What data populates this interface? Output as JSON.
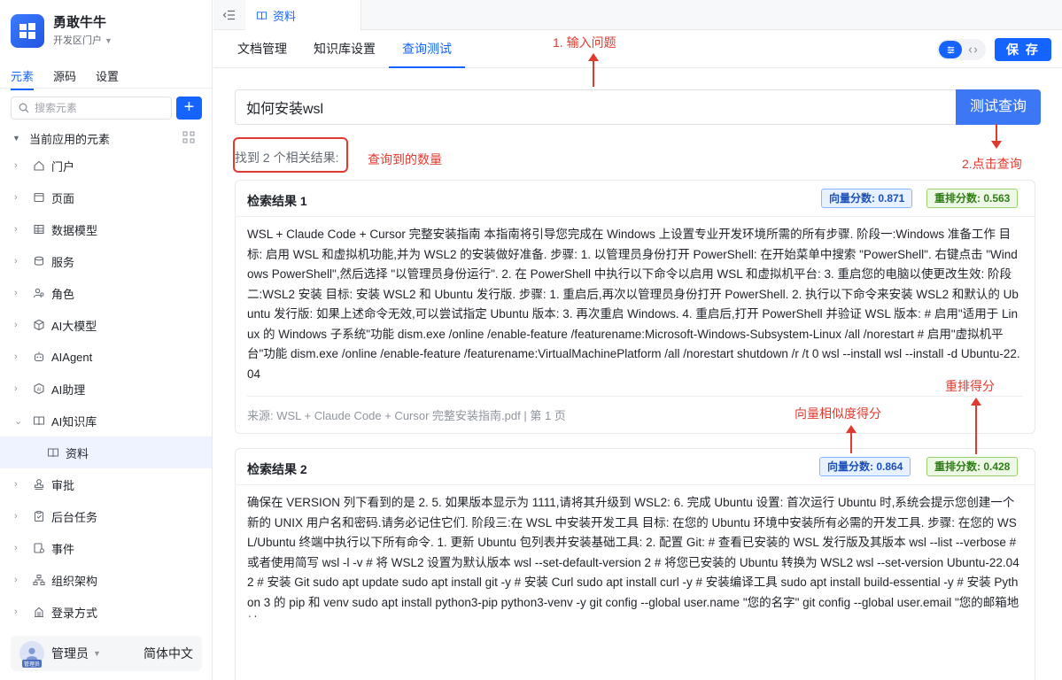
{
  "app": {
    "name": "勇敢牛牛",
    "subtitle": "开发区门户"
  },
  "sidebar": {
    "tabs": [
      {
        "label": "元素"
      },
      {
        "label": "源码"
      },
      {
        "label": "设置"
      }
    ],
    "search_placeholder": "搜索元素",
    "add_label": "+",
    "tree_title": "当前应用的元素",
    "items": [
      {
        "label": "门户"
      },
      {
        "label": "页面"
      },
      {
        "label": "数据模型"
      },
      {
        "label": "服务"
      },
      {
        "label": "角色"
      },
      {
        "label": "AI大模型"
      },
      {
        "label": "AIAgent"
      },
      {
        "label": "AI助理"
      },
      {
        "label": "AI知识库"
      },
      {
        "label": "资料"
      },
      {
        "label": "审批"
      },
      {
        "label": "后台任务"
      },
      {
        "label": "事件"
      },
      {
        "label": "组织架构"
      },
      {
        "label": "登录方式"
      }
    ],
    "user": {
      "name": "管理员",
      "avatar_caption": "管理员",
      "language": "简体中文"
    }
  },
  "topbar": {
    "tab_label": "资料"
  },
  "subnav": {
    "tabs": [
      {
        "label": "文档管理"
      },
      {
        "label": "知识库设置"
      },
      {
        "label": "查询测试"
      }
    ],
    "save_label": "保 存"
  },
  "query": {
    "value": "如何安装wsl",
    "button_label": "测试查询"
  },
  "results_summary": "找到 2 个相关结果:",
  "results": [
    {
      "title": "检索结果 1",
      "vector_score": "向量分数: 0.871",
      "rerank_score": "重排分数: 0.563",
      "body": "WSL + Claude Code + Cursor 完整安装指南 本指南将引导您完成在 Windows 上设置专业开发环境所需的所有步骤. 阶段一:Windows 准备工作 目标: 启用 WSL 和虚拟机功能,并为 WSL2 的安装做好准备. 步骤: 1. 以管理员身份打开 PowerShell: 在开始菜单中搜索 \"PowerShell\". 右键点击 \"Windows PowerShell\",然后选择 \"以管理员身份运行\". 2. 在 PowerShell 中执行以下命令以启用 WSL 和虚拟机平台: 3. 重启您的电脑以使更改生效: 阶段二:WSL2 安装 目标: 安装 WSL2 和 Ubuntu 发行版. 步骤: 1. 重启后,再次以管理员身份打开 PowerShell. 2. 执行以下命令来安装 WSL2 和默认的 Ubuntu 发行版: 如果上述命令无效,可以尝试指定 Ubuntu 版本: 3. 再次重启 Windows. 4. 重启后,打开 PowerShell 并验证 WSL 版本: # 启用\"适用于 Linux 的 Windows 子系统\"功能 dism.exe /online /enable-feature /featurename:Microsoft-Windows-Subsystem-Linux /all /norestart # 启用\"虚拟机平台\"功能 dism.exe /online /enable-feature /featurename:VirtualMachinePlatform /all /norestart shutdown /r /t 0 wsl --install wsl --install -d Ubuntu-22.04",
      "source": "来源: WSL + Claude Code + Cursor 完整安装指南.pdf | 第 1 页"
    },
    {
      "title": "检索结果 2",
      "vector_score": "向量分数: 0.864",
      "rerank_score": "重排分数: 0.428",
      "body": "确保在 VERSION 列下看到的是 2. 5. 如果版本显示为 1111,请将其升级到 WSL2: 6. 完成 Ubuntu 设置: 首次运行 Ubuntu 时,系统会提示您创建一个新的 UNIX 用户名和密码.请务必记住它们. 阶段三:在 WSL 中安装开发工具 目标: 在您的 Ubuntu 环境中安装所有必需的开发工具. 步骤: 在您的 WSL/Ubuntu 终端中执行以下所有命令. 1. 更新 Ubuntu 包列表并安装基础工具: 2. 配置 Git: # 查看已安装的 WSL 发行版及其版本 wsl --list --verbose # 或者使用简写 wsl -l -v # 将 WSL2 设置为默认版本 wsl --set-default-version 2 # 将您已安装的 Ubuntu 转换为 WSL2 wsl --set-version Ubuntu-22.04 2 # 安装 Git sudo apt update sudo apt install git -y # 安装 Curl sudo apt install curl -y # 安装编译工具 sudo apt install build-essential -y # 安装 Python 3 的 pip 和 venv sudo apt install python3-pip python3-venv -y git config --global user.name \"您的名字\" git config --global user.email \"您的邮箱地址\" git config --global init.defaultBranch main"
    }
  ],
  "annotations": {
    "input_question": "1. 输入问题",
    "click_query": "2.点击查询",
    "count_label": "查询到的数量",
    "vector_label": "向量相似度得分",
    "rerank_label": "重排得分"
  },
  "colors": {
    "primary": "#1664ff",
    "annotation": "#e03a2f"
  }
}
